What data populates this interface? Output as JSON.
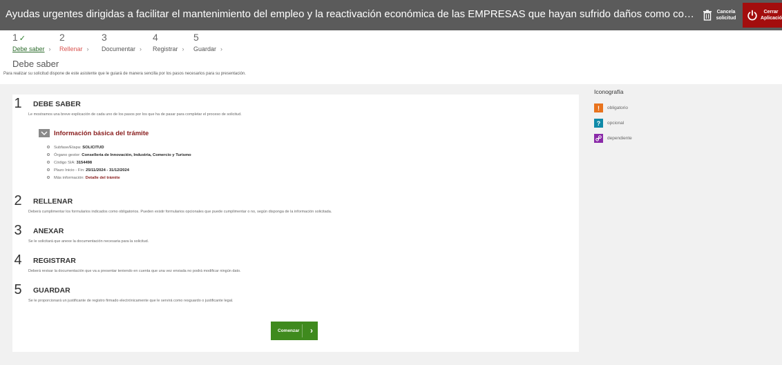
{
  "header": {
    "title": "Ayudas urgentes dirigidas a facilitar el mantenimiento del empleo y la reactivación económica de las EMPRESAS que hayan sufrido daños como consecuencia del temporal de lluvia y vie...",
    "cancel_label": "Cancela solicitud",
    "close_label": "Cerrar Aplicación",
    "cancel_icon": "trash-icon",
    "close_icon": "power-icon"
  },
  "steps": [
    {
      "num": "1",
      "check": "✓",
      "label": "Debe saber"
    },
    {
      "num": "2",
      "check": "",
      "label": "Rellenar"
    },
    {
      "num": "3",
      "check": "",
      "label": "Documentar"
    },
    {
      "num": "4",
      "check": "",
      "label": "Registrar"
    },
    {
      "num": "5",
      "check": "",
      "label": "Guardar"
    }
  ],
  "page": {
    "title": "Debe saber",
    "subtitle": "Para realizar su solicitud dispone de este asistente que le guiará de manera sencilla por los pasos necesarios para su presentación."
  },
  "sections": [
    {
      "num": "1",
      "title": "DEBE SABER",
      "desc": "Le mostramos una breve explicación de cada uno de los pasos por los que ha de pasar para completar el proceso de solicitud."
    },
    {
      "num": "2",
      "title": "RELLENAR",
      "desc": "Deberá cumplimentar los formularios indicados como obligatorios. Pueden existir formularios opcionales que puede cumplimentar o no, según disponga de la información solicitada."
    },
    {
      "num": "3",
      "title": "ANEXAR",
      "desc": "Se le solicitará que anexe la documentación necesaria para la solicitud."
    },
    {
      "num": "4",
      "title": "REGISTRAR",
      "desc": "Deberá revisar la documentación que va a presentar teniendo en cuenta que una vez enviada no podrá modificar ningún dato."
    },
    {
      "num": "5",
      "title": "GUARDAR",
      "desc": "Se le proporcionará un justificante de registro firmado electrónicamente que le servirá como resguardo o justificante legal."
    }
  ],
  "info": {
    "toggle_label": "Información básica del trámite",
    "items": [
      {
        "label": "Subfase/Etapa:",
        "value": "SOLICITUD"
      },
      {
        "label": "Órgano gestor:",
        "value": "Conselleria de Innovación, Industria, Comercio y Turismo"
      },
      {
        "label": "Código SIA:",
        "value": "3154498"
      },
      {
        "label": "Plazo Inicio - Fin:",
        "value": "25/11/2024 - 31/12/2024"
      },
      {
        "label": "Más información:",
        "value": "Detalle del trámite"
      }
    ]
  },
  "start_button": "Comenzar",
  "legend": {
    "title": "Iconografía",
    "items": [
      {
        "glyph": "!",
        "label": "obligatorio",
        "color": "#e8731e"
      },
      {
        "glyph": "?",
        "label": "opcional",
        "color": "#0f8aa8"
      },
      {
        "glyph": "🔗",
        "label": "dependiente",
        "color": "#8a2aa8"
      }
    ]
  },
  "colors": {
    "topbar": "#5b5b5b",
    "close_button": "#a30d0d",
    "start_button": "#3f8a1e",
    "done_step": "#2a6a2a",
    "current_step": "#d9534f"
  }
}
